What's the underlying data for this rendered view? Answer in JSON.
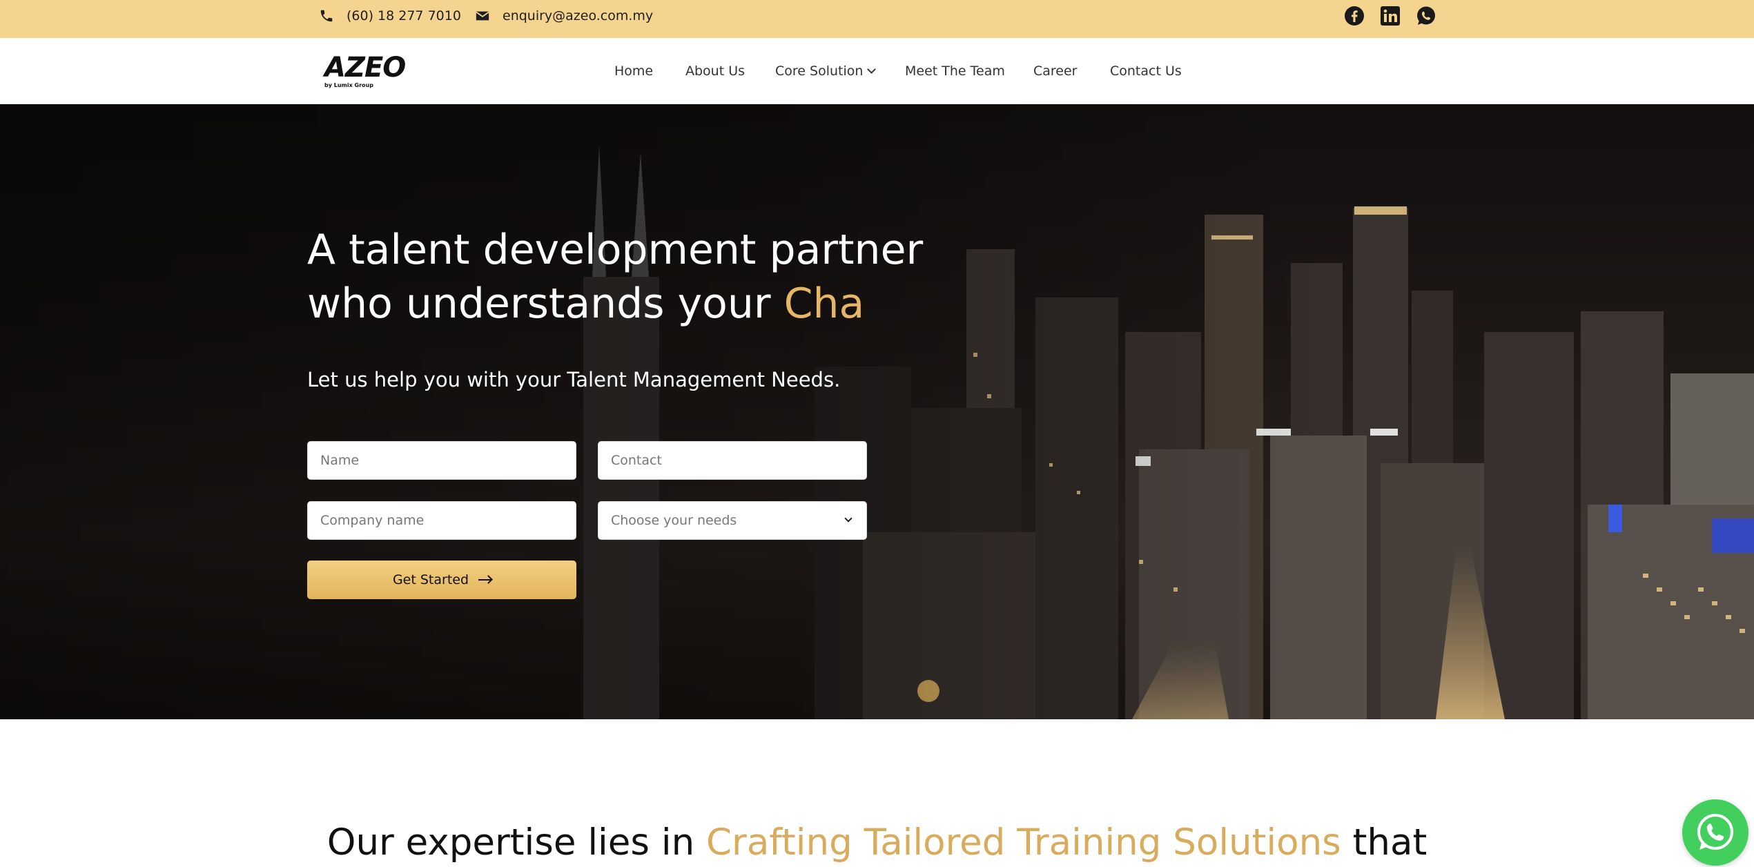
{
  "topbar": {
    "phone": "(60) 18 277 7010",
    "email": "enquiry@azeo.com.my",
    "social": [
      "facebook-icon",
      "linkedin-icon",
      "whatsapp-icon"
    ],
    "bg_color": "#f4d48e"
  },
  "header": {
    "logo_text": "AZEO",
    "logo_sub": "by Lumix Group",
    "nav": {
      "home": "Home",
      "about": "About Us",
      "core": "Core Solution",
      "team": "Meet The Team",
      "career": "Career",
      "contact": "Contact Us"
    }
  },
  "hero": {
    "title_line1": "A talent development partner",
    "title_line2_prefix": "who understands your ",
    "title_line2_accent": "Cha",
    "subtitle": "Let us help you with your Talent Management Needs.",
    "form": {
      "name_placeholder": "Name",
      "contact_placeholder": "Contact",
      "company_placeholder": "Company name",
      "needs_selected": "Choose your needs",
      "submit_label": "Get Started"
    },
    "accent_color": "#e6b566"
  },
  "expertise": {
    "prefix": "Our expertise lies in ",
    "accent": "Crafting Tailored Training Solutions",
    "suffix": " that"
  }
}
